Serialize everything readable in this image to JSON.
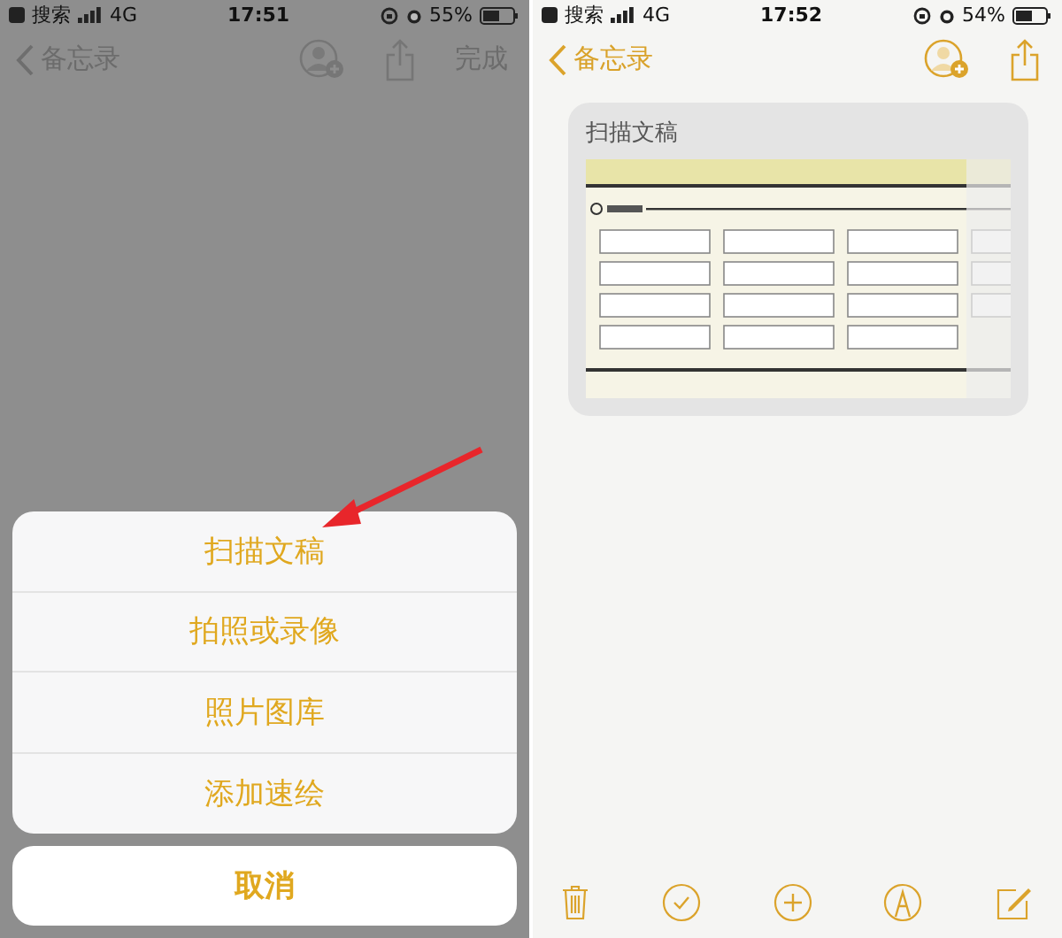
{
  "left": {
    "status_bar": {
      "back_app": "搜索",
      "network": "4G",
      "time": "17:51",
      "battery": "55%"
    },
    "nav": {
      "back": "备忘录",
      "done": "完成"
    },
    "action_sheet": {
      "items": [
        {
          "label": "扫描文稿"
        },
        {
          "label": "拍照或录像"
        },
        {
          "label": "照片图库"
        },
        {
          "label": "添加速绘"
        }
      ],
      "cancel": "取消"
    }
  },
  "right": {
    "status_bar": {
      "back_app": "搜索",
      "network": "4G",
      "time": "17:52",
      "battery": "54%"
    },
    "nav": {
      "back": "备忘录"
    },
    "note": {
      "title": "扫描文稿"
    }
  }
}
